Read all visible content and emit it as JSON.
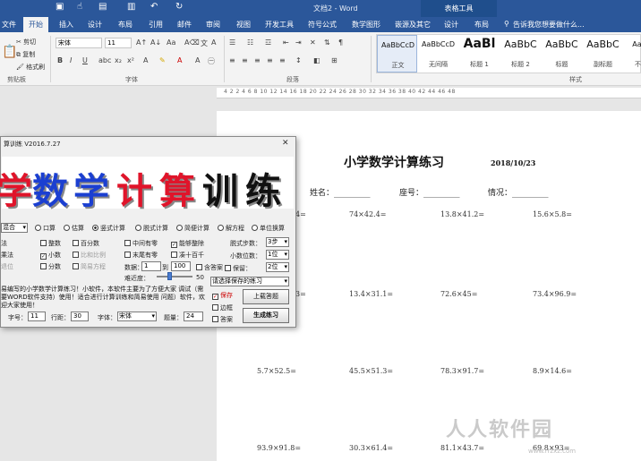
{
  "window": {
    "doc_title": "文档2 - Word",
    "table_tools": "表格工具"
  },
  "tabs": [
    "文件",
    "开始",
    "插入",
    "设计",
    "布局",
    "引用",
    "邮件",
    "审阅",
    "视图",
    "开发工具",
    "符号公式",
    "数学图形",
    "嵌源及其它",
    "设计",
    "布局"
  ],
  "tell_me": "告诉我您想要做什么...",
  "ribbon": {
    "cut": "剪切",
    "copy": "复制",
    "format_painter": "格式刷",
    "font_name": "宋体",
    "font_size": "11",
    "groups": {
      "clipboard": "剪贴板",
      "font": "字体",
      "paragraph": "段落",
      "styles": "样式"
    },
    "styles": [
      {
        "sample": "AaBbCcD",
        "name": "正文"
      },
      {
        "sample": "AaBbCcD",
        "name": "无间隔"
      },
      {
        "sample": "AaBl",
        "name": "标题 1"
      },
      {
        "sample": "AaBbC",
        "name": "标题 2"
      },
      {
        "sample": "AaBbC",
        "name": "标题"
      },
      {
        "sample": "AaBbC",
        "name": "副标题"
      },
      {
        "sample": "AaBbC",
        "name": "不明显"
      }
    ]
  },
  "ruler_text": "4 2 2 4 6 8 10 12 14 16 18 20 22 24 26 28 30 32 34 36 38 40 42 44 46 48",
  "document": {
    "title": "小学数学计算练习",
    "date": "2018/10/23",
    "name_label": "姓名：_________",
    "seat_label": "座号：_________",
    "score_label": "情况：_________",
    "problems": [
      [
        "4=",
        "74×42.4=",
        "13.8×41.2=",
        "15.6×5.8="
      ],
      [
        "3=",
        "13.4×31.1=",
        "72.6×45=",
        "73.4×96.9="
      ],
      [
        "5.7×52.5=",
        "45.5×51.3=",
        "78.3×91.7=",
        "8.9×14.6="
      ],
      [
        "93.9×91.8=",
        "30.3×61.4=",
        "81.1×43.7=",
        "69.8×93="
      ]
    ]
  },
  "watermark": {
    "text": "人人软件园",
    "url": "www.rrzxz.com"
  },
  "dialog": {
    "title": "算训练 V2016.7.27",
    "banner": [
      "学",
      "数",
      "学",
      "计",
      "算",
      "训",
      "练"
    ],
    "banner_colors": [
      "#e0142a",
      "#1b3fd1",
      "#1b3fd1",
      "#e0142a",
      "#e0142a",
      "#111111",
      "#111111"
    ],
    "mode_select": "混合",
    "modes": [
      "口算",
      "估算",
      "竖式计算",
      "脱式计算",
      "简便计算",
      "解方程",
      "单位换算"
    ],
    "ops": [
      "法",
      "乘法",
      "退位"
    ],
    "opt_col1": [
      "整数",
      "小数",
      "分数"
    ],
    "opt_col2": [
      "百分数",
      "比和比例",
      "简易方程"
    ],
    "opt_col3": [
      "中间有零",
      "末尾有零"
    ],
    "opt_col4": [
      "能够整除",
      "凑十百千"
    ],
    "steps_label": "脱式步数：",
    "steps_value": "3步",
    "decimal_label": "小数位数：",
    "decimal_value": "1位",
    "keep_label": "保留：",
    "keep_value": "2位",
    "range_label": "数据：",
    "range_min": "1",
    "range_to": "到",
    "range_max": "100",
    "has_answer": "含答案",
    "difficulty_label": "难近度：",
    "difficulty_value": "50",
    "practice_select": "请选择保存的练习",
    "save": "保存",
    "border": "边框",
    "answer": "答案",
    "btn_load": "上载答题",
    "btn_generate": "生成练习",
    "notice": "易编写的小学数学计算练习！小软件，本软件主要为了方便大家 调试（需要WORD软件支持）使用！适合进行计算训练和简易使用 问题）软件，欢迎大家使用！",
    "font_size_label": "字号：",
    "font_size_value": "11",
    "line_label": "行距：",
    "line_value": "30",
    "font_label": "字体：",
    "font_value": "宋体",
    "count_label": "题量：",
    "count_value": "24"
  }
}
